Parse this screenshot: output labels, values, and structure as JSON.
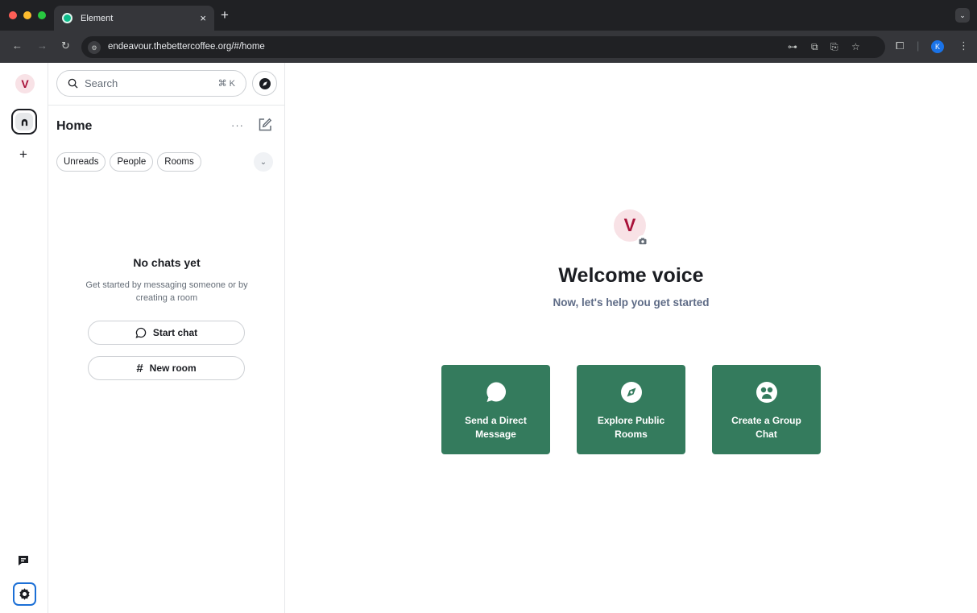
{
  "browser": {
    "tab_title": "Element",
    "tab_close": "×",
    "new_tab": "+",
    "url": "endeavour.thebettercoffee.org/#/home",
    "profile_initial": "K"
  },
  "spaces": {
    "user_initial": "V"
  },
  "room_list": {
    "search_placeholder": "Search",
    "search_shortcut": "⌘ K",
    "title": "Home",
    "more": "···",
    "filters": [
      "Unreads",
      "People",
      "Rooms"
    ],
    "empty_title": "No chats yet",
    "empty_body": "Get started by messaging someone or by creating a room",
    "start_chat": "Start chat",
    "new_room": "New room"
  },
  "welcome": {
    "avatar_initial": "V",
    "title": "Welcome voice",
    "subtitle": "Now, let's help you get started",
    "cards": [
      {
        "label": "Send a Direct Message",
        "icon": "chat-bubble-icon"
      },
      {
        "label": "Explore Public Rooms",
        "icon": "compass-icon"
      },
      {
        "label": "Create a Group Chat",
        "icon": "group-icon"
      }
    ]
  },
  "colors": {
    "accent": "#347b5d",
    "avatar_bg": "#f8e2e6",
    "avatar_fg": "#a81139"
  }
}
